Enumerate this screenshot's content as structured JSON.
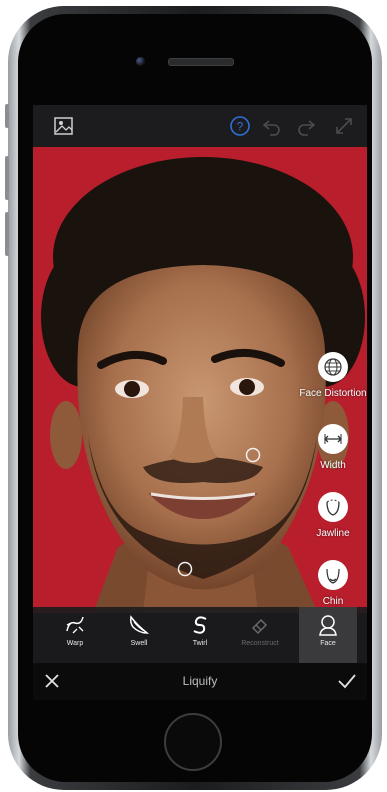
{
  "screen": {
    "top_bar": {
      "icons": [
        "gallery-icon",
        "help-icon",
        "undo-icon",
        "redo-icon",
        "expand-icon"
      ]
    },
    "face_panel": [
      {
        "label": "Face Distortion",
        "icon": "globe-grid-icon"
      },
      {
        "label": "Width",
        "icon": "width-icon"
      },
      {
        "label": "Jawline",
        "icon": "jawline-icon"
      },
      {
        "label": "Chin",
        "icon": "chin-icon"
      }
    ],
    "tools": [
      {
        "label": "Warp",
        "icon": "warp-icon"
      },
      {
        "label": "Swell",
        "icon": "swell-icon"
      },
      {
        "label": "Twirl",
        "icon": "twirl-icon"
      },
      {
        "label": "Reconstruct",
        "icon": "eraser-icon"
      },
      {
        "label": "Face",
        "icon": "face-icon"
      }
    ],
    "active_tool": "Face",
    "bottom_bar": {
      "title": "Liquify",
      "cancel_icon": "close-icon",
      "confirm_icon": "check-icon"
    }
  },
  "colors": {
    "background": "#b81e2c",
    "toolbar": "#1c1c1e",
    "accent_help": "#2f6fd6"
  }
}
